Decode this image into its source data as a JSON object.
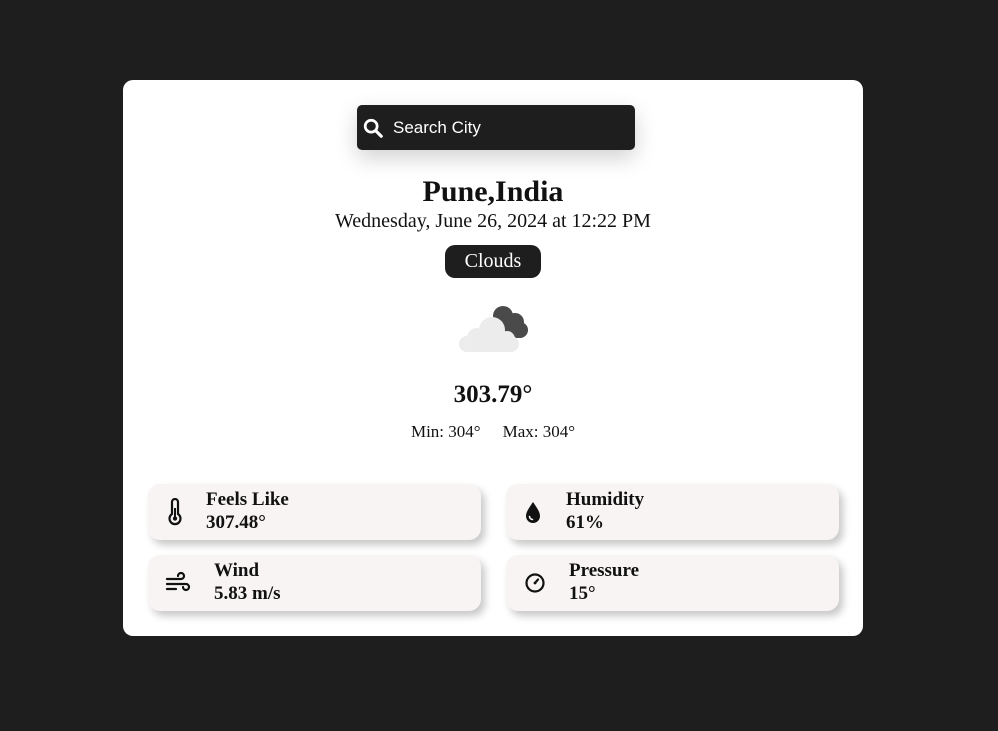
{
  "search": {
    "placeholder": "Search City",
    "value": ""
  },
  "location": {
    "city": "Pune,India"
  },
  "datetime": "Wednesday, June 26, 2024 at 12:22 PM",
  "condition": "Clouds",
  "condition_icon": "clouds-icon",
  "temperature": "303.79°",
  "min_label": "Min: 304°",
  "max_label": "Max: 304°",
  "stats": {
    "feels_like": {
      "label": "Feels Like",
      "value": "307.48°",
      "icon": "thermometer-icon"
    },
    "humidity": {
      "label": "Humidity",
      "value": "61%",
      "icon": "water-drop-icon"
    },
    "wind": {
      "label": "Wind",
      "value": "5.83 m/s",
      "icon": "wind-icon"
    },
    "pressure": {
      "label": "Pressure",
      "value": "15°",
      "icon": "gauge-icon"
    }
  },
  "colors": {
    "background": "#1e1e1e",
    "card": "#ffffff",
    "tile": "#f7f4f3",
    "accent_dark": "#1e1e1e"
  }
}
